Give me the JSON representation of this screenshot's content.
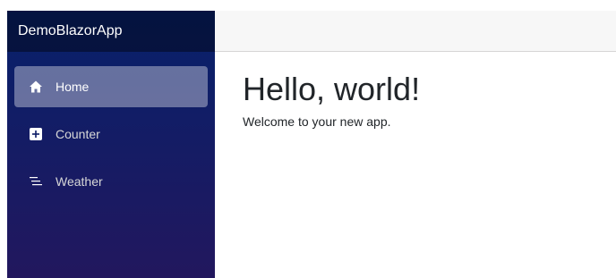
{
  "brand": "DemoBlazorApp",
  "nav": {
    "items": [
      {
        "label": "Home",
        "icon": "home-icon",
        "active": true
      },
      {
        "label": "Counter",
        "icon": "plus-square-icon",
        "active": false
      },
      {
        "label": "Weather",
        "icon": "list-icon",
        "active": false
      }
    ]
  },
  "main": {
    "title": "Hello, world!",
    "subtitle": "Welcome to your new app."
  },
  "colors": {
    "sidebar_top": "#07216b",
    "sidebar_bottom": "#22175e",
    "top_row": "#f7f7f7"
  }
}
